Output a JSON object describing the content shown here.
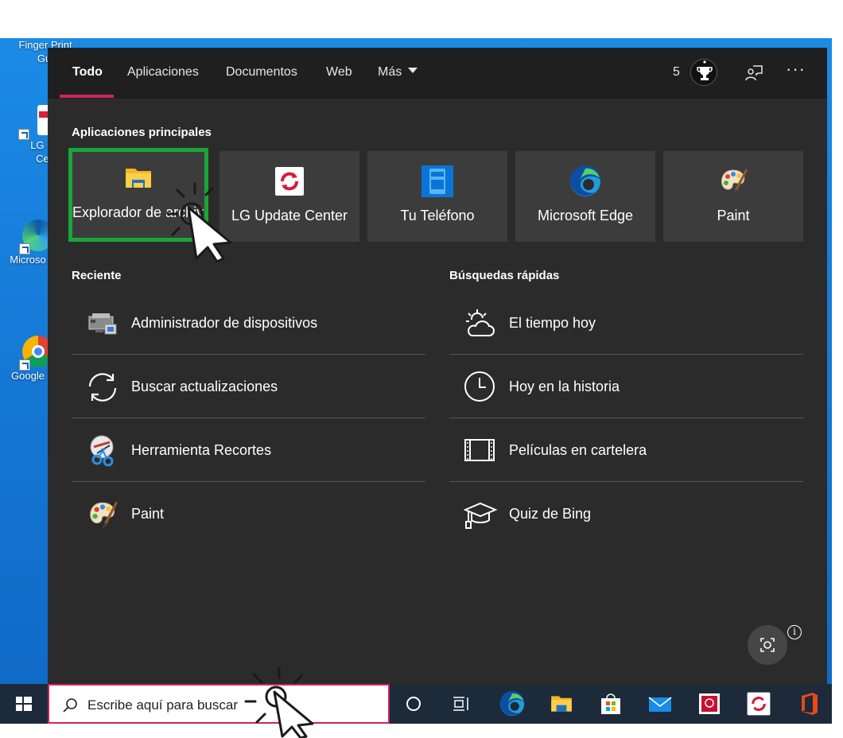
{
  "desktop": {
    "icons": [
      {
        "label": "Finger Print Gui"
      },
      {
        "label": "LG Co Cen"
      },
      {
        "label": "Microso"
      },
      {
        "label": "Google"
      }
    ]
  },
  "search_panel": {
    "tabs": [
      {
        "label": "Todo",
        "active": true
      },
      {
        "label": "Aplicaciones"
      },
      {
        "label": "Documentos"
      },
      {
        "label": "Web"
      },
      {
        "label": "Más"
      }
    ],
    "rewards_points": "5",
    "more_label": "···",
    "top_apps_title": "Aplicaciones principales",
    "top_apps": [
      {
        "label": "Explorador de archivos",
        "icon": "folder-icon",
        "selected": true
      },
      {
        "label": "LG Update Center",
        "icon": "lg-update-icon"
      },
      {
        "label": "Tu Teléfono",
        "icon": "phone-icon"
      },
      {
        "label": "Microsoft Edge",
        "icon": "edge-icon"
      },
      {
        "label": "Paint",
        "icon": "paint-palette-icon"
      }
    ],
    "recent_title": "Reciente",
    "recent": [
      {
        "label": "Administrador de dispositivos",
        "icon": "device-manager-icon"
      },
      {
        "label": "Buscar actualizaciones",
        "icon": "refresh-icon"
      },
      {
        "label": "Herramienta Recortes",
        "icon": "snipping-tool-icon"
      },
      {
        "label": "Paint",
        "icon": "paint-palette-icon"
      }
    ],
    "quick_title": "Búsquedas rápidas",
    "quick": [
      {
        "label": "El tiempo hoy",
        "icon": "weather-icon"
      },
      {
        "label": "Hoy en la historia",
        "icon": "clock-icon"
      },
      {
        "label": "Películas en cartelera",
        "icon": "film-icon"
      },
      {
        "label": "Quiz de Bing",
        "icon": "graduation-cap-icon"
      }
    ],
    "info_label": "i"
  },
  "taskbar": {
    "search_placeholder": "Escribe aquí para buscar",
    "icons": [
      "windows-start-icon",
      "search-icon",
      "cortana-icon",
      "task-view-icon",
      "edge-icon",
      "file-explorer-icon",
      "store-icon",
      "mail-icon",
      "app-red-icon",
      "lg-update-icon",
      "office-icon"
    ]
  },
  "colors": {
    "accent": "#d1235f",
    "selection": "#1aa539",
    "panel_bg": "#2b2b2b",
    "tile_bg": "#3c3c3c",
    "desktop_bg": "#1679d6",
    "taskbar_bg": "#1c2a3a"
  }
}
